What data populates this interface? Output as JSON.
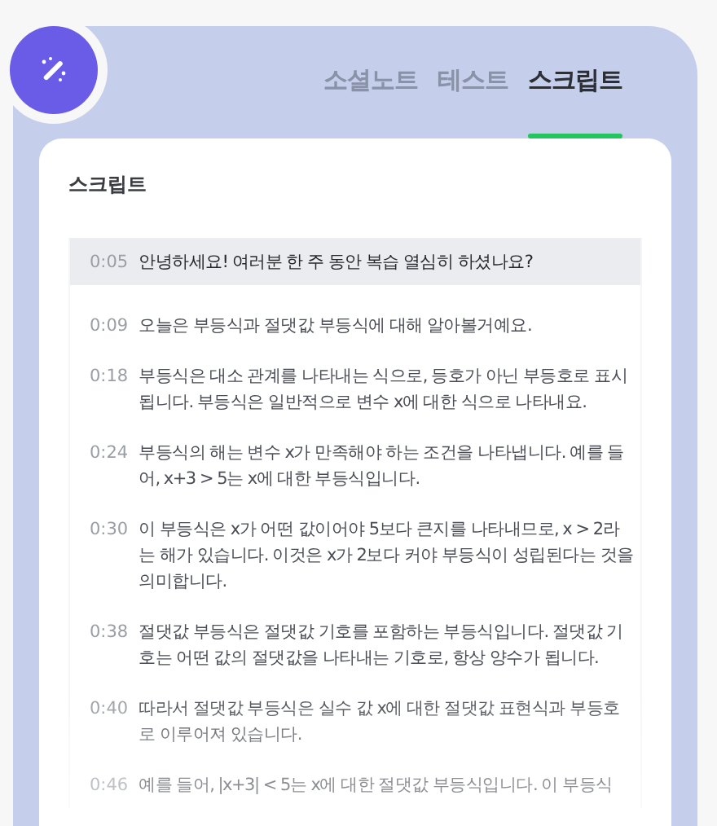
{
  "tabs": [
    {
      "label": "소셜노트",
      "selected": false
    },
    {
      "label": "테스트",
      "selected": false
    },
    {
      "label": "스크립트",
      "selected": true
    }
  ],
  "card": {
    "title": "스크립트"
  },
  "rows": [
    {
      "time": "0:05",
      "text": "안녕하세요! 여러분 한 주 동안 복습 열심히 하셨나요?",
      "selected": true
    },
    {
      "time": "0:09",
      "text": "오늘은 부등식과 절댓값 부등식에 대해 알아볼거예요.",
      "selected": false
    },
    {
      "time": "0:18",
      "text": "부등식은 대소 관계를 나타내는 식으로, 등호가 아닌 부등호로 표시됩니다. 부등식은 일반적으로 변수 x에 대한 식으로 나타내요.",
      "selected": false
    },
    {
      "time": "0:24",
      "text": "부등식의 해는 변수 x가 만족해야 하는 조건을 나타냅니다. 예를 들어, x+3 > 5는 x에 대한 부등식입니다.",
      "selected": false
    },
    {
      "time": "0:30",
      "text": "이 부등식은 x가 어떤 값이어야 5보다 큰지를 나타내므로, x > 2라는 해가 있습니다. 이것은 x가 2보다 커야 부등식이 성립된다는 것을 의미합니다.",
      "selected": false
    },
    {
      "time": "0:38",
      "text": "절댓값 부등식은 절댓값 기호를 포함하는 부등식입니다. 절댓값 기호는 어떤 값의 절댓값을 나타내는 기호로, 항상 양수가 됩니다.",
      "selected": false
    },
    {
      "time": "0:40",
      "text": "따라서 절댓값 부등식은 실수 값 x에 대한 절댓값 표현식과 부등호로 이루어져 있습니다.",
      "selected": false
    },
    {
      "time": "0:46",
      "text": "예를 들어, |x+3| < 5는 x에 대한 절댓값 부등식입니다. 이 부등식",
      "selected": false
    }
  ]
}
